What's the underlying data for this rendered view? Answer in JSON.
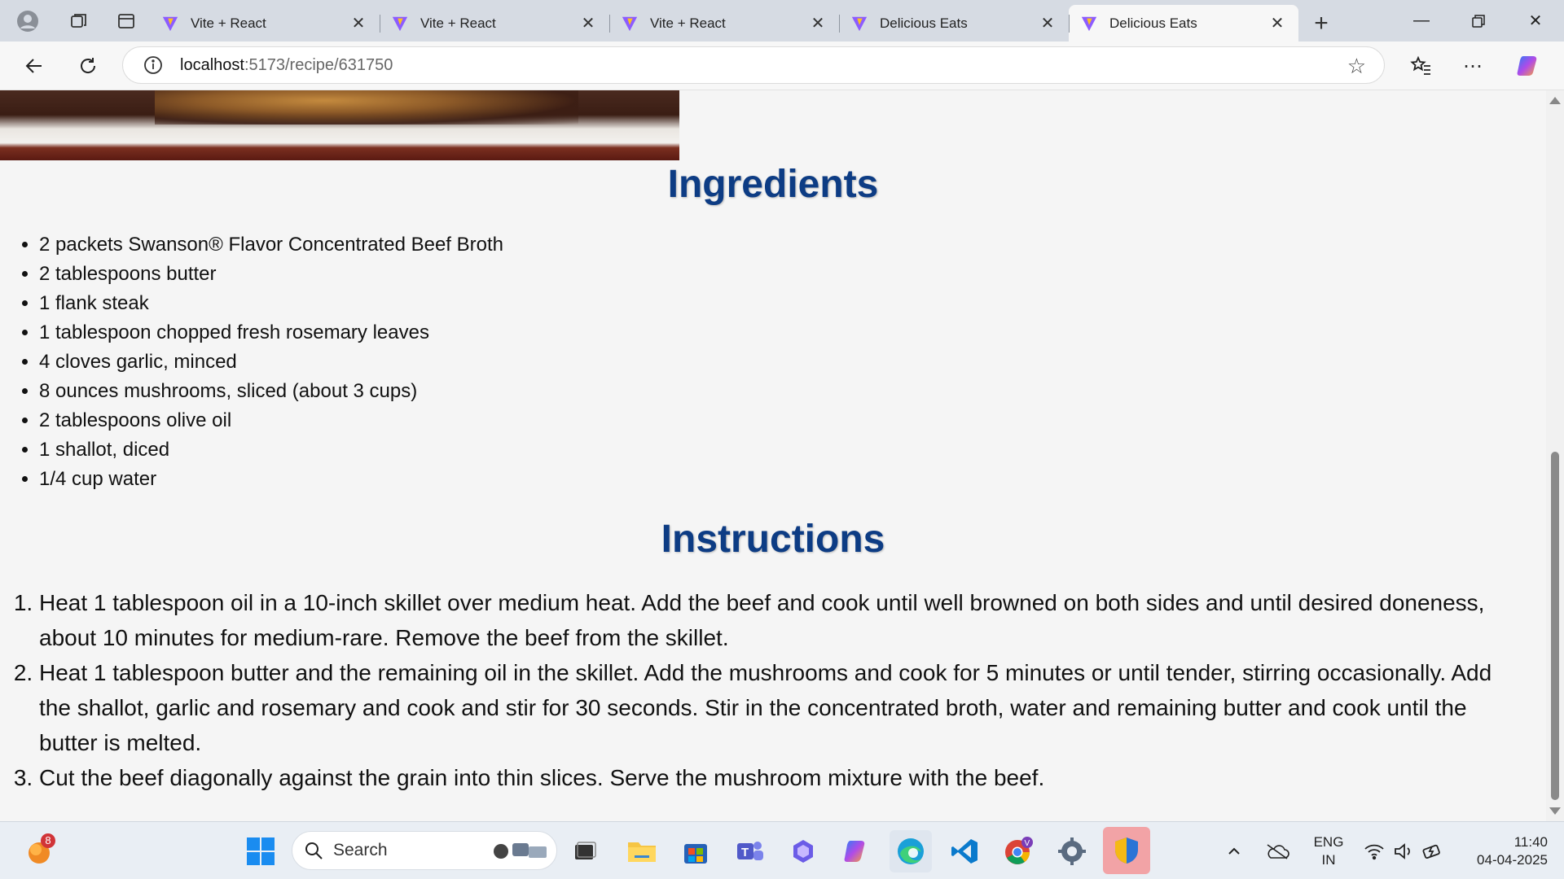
{
  "browser": {
    "tabs": [
      {
        "title": "Vite + React",
        "active": false
      },
      {
        "title": "Vite + React",
        "active": false
      },
      {
        "title": "Vite + React",
        "active": false
      },
      {
        "title": "Delicious Eats",
        "active": false
      },
      {
        "title": "Delicious Eats",
        "active": true
      }
    ],
    "url_host": "localhost",
    "url_path": ":5173/recipe/631750"
  },
  "recipe": {
    "ingredients_heading": "Ingredients",
    "ingredients": [
      "2 packets Swanson® Flavor Concentrated Beef Broth",
      "2 tablespoons butter",
      "1 flank steak",
      "1 tablespoon chopped fresh rosemary leaves",
      "4 cloves garlic, minced",
      "8 ounces mushrooms, sliced (about 3 cups)",
      "2 tablespoons olive oil",
      "1 shallot, diced",
      "1/4 cup water"
    ],
    "instructions_heading": "Instructions",
    "instructions": [
      "Heat 1 tablespoon oil in a 10-inch skillet over medium heat. Add the beef and cook until well browned on both sides and until desired doneness, about 10 minutes for medium-rare. Remove the beef from the skillet.",
      "Heat 1 tablespoon butter and the remaining oil in the skillet. Add the mushrooms and cook for 5 minutes or until tender, stirring occasionally. Add the shallot, garlic and rosemary and cook and stir for 30 seconds. Stir in the concentrated broth, water and remaining butter and cook until the butter is melted.",
      "Cut the beef diagonally against the grain into thin slices. Serve the mushroom mixture with the beef."
    ]
  },
  "taskbar": {
    "search_label": "Search",
    "notification_badge": "8",
    "lang_line1": "ENG",
    "lang_line2": "IN",
    "time": "11:40",
    "date": "04-04-2025"
  },
  "colors": {
    "heading": "#0d3c84",
    "vite_purple": "#8c5cff",
    "vite_yellow": "#ffc21a"
  }
}
